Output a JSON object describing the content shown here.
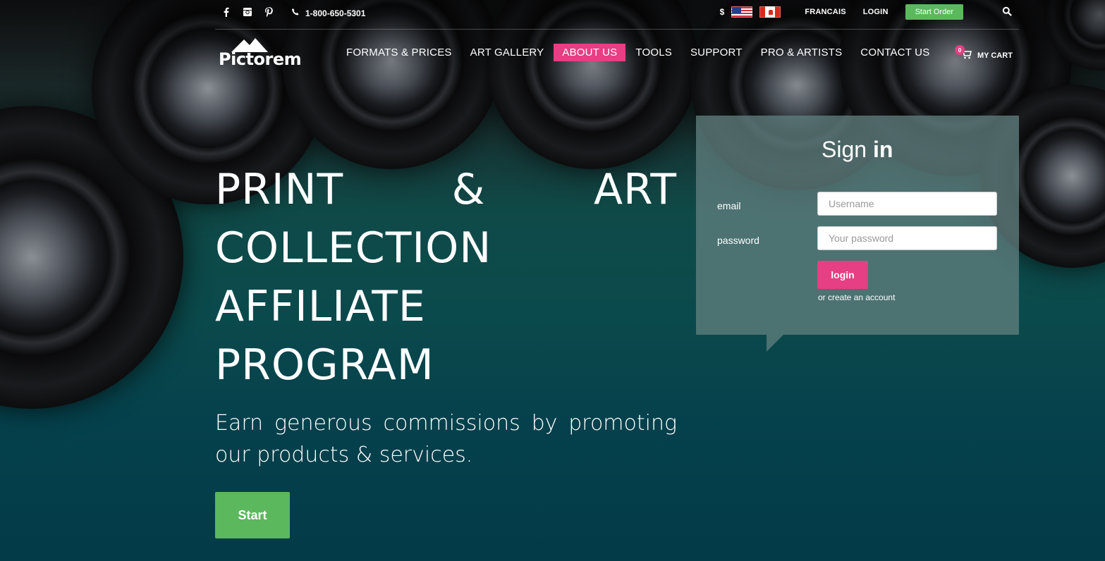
{
  "topbar": {
    "phone": "1-800-650-5301",
    "currency": "$",
    "language_link": "FRANCAIS",
    "login_link": "LOGIN",
    "start_order": "Start Order"
  },
  "logo": {
    "text": "Pictorem"
  },
  "nav": {
    "items": [
      {
        "label": "FORMATS & PRICES"
      },
      {
        "label": "ART GALLERY"
      },
      {
        "label": "ABOUT US"
      },
      {
        "label": "TOOLS"
      },
      {
        "label": "SUPPORT"
      },
      {
        "label": "PRO & ARTISTS"
      },
      {
        "label": "CONTACT US"
      }
    ],
    "active_index": 2
  },
  "cart": {
    "label": "MY CART",
    "count": "0"
  },
  "hero": {
    "title_line1_a": "PRINT",
    "title_line1_b": "&",
    "title_line1_c": "ART",
    "title_line2": "COLLECTION",
    "title_line3": "AFFILIATE",
    "title_line4": "PROGRAM",
    "subtitle": "Earn generous commissions by promoting our products & services.",
    "start_button": "Start"
  },
  "signin": {
    "title_a": "Sign",
    "title_b": "in",
    "email_label": "email",
    "email_placeholder": "Username",
    "password_label": "password",
    "password_placeholder": "Your password",
    "login_button": "login",
    "create_account": "or create an account"
  },
  "colors": {
    "accent_pink": "#e63f83",
    "accent_green": "#5cb85c",
    "panel_bg": "#5f7d7d"
  },
  "icons": [
    "facebook-icon",
    "instagram-icon",
    "pinterest-icon",
    "phone-icon",
    "us-flag-icon",
    "canada-flag-icon",
    "search-icon",
    "cart-icon"
  ]
}
